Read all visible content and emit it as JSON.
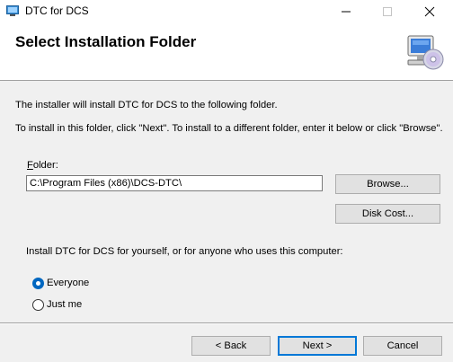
{
  "window": {
    "title": "DTC for DCS",
    "app_icon": "installer-icon"
  },
  "banner": {
    "title": "Select Installation Folder",
    "icon": "computer-cd-icon"
  },
  "body": {
    "info_line1": "The installer will install DTC for DCS to the following folder.",
    "info_line2": "To install in this folder, click \"Next\". To install to a different folder, enter it below or click \"Browse\".",
    "folder_label_accel": "F",
    "folder_label_rest": "older:",
    "folder_value": "C:\\Program Files (x86)\\DCS-DTC\\",
    "browse_label": "Browse...",
    "disk_cost_label": "Disk Cost...",
    "install_for_prompt": "Install DTC for DCS for yourself, or for anyone who uses this computer:",
    "options": [
      {
        "label": "Everyone",
        "selected": true
      },
      {
        "label": "Just me",
        "selected": false
      }
    ]
  },
  "footer": {
    "back_label": "< Back",
    "next_label": "Next >",
    "cancel_label": "Cancel"
  },
  "colors": {
    "accent": "#0067c0",
    "dialog_bg": "#f0f0f0",
    "button_bg": "#e1e1e1"
  }
}
